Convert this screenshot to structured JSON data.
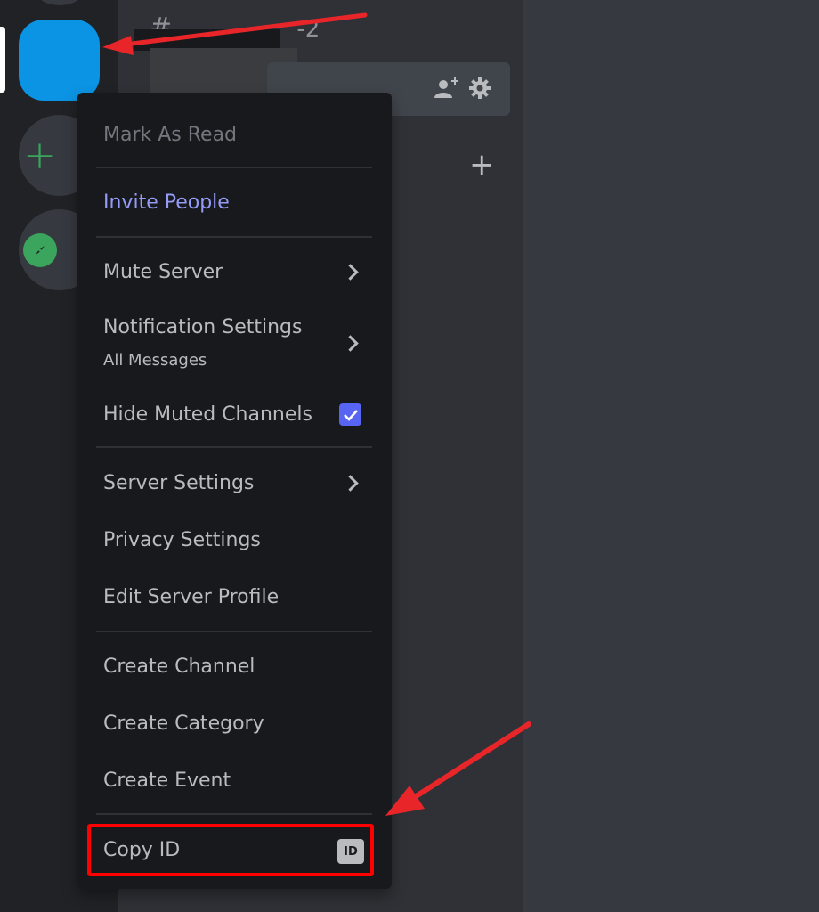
{
  "server_rail": {
    "selected_server_color": "#0b94e3",
    "add_server_icon": "plus-icon",
    "explore_icon": "compass-icon"
  },
  "channel_sidebar": {
    "header_channel_hash": "#",
    "header_channel_suffix": "-2",
    "invite_icon": "add-member-icon",
    "settings_icon": "gear-icon",
    "add_channel_icon": "plus-icon"
  },
  "context_menu": {
    "items": [
      {
        "label": "Mark As Read",
        "state": "disabled"
      },
      {
        "label": "Invite People",
        "state": "brand"
      },
      {
        "label": "Mute Server",
        "submenu": true
      },
      {
        "label": "Notification Settings",
        "sublabel": "All Messages",
        "submenu": true
      },
      {
        "label": "Hide Muted Channels",
        "checked": true
      },
      {
        "label": "Server Settings",
        "submenu": true
      },
      {
        "label": "Privacy Settings"
      },
      {
        "label": "Edit Server Profile"
      },
      {
        "label": "Create Channel"
      },
      {
        "label": "Create Category"
      },
      {
        "label": "Create Event"
      },
      {
        "label": "Copy ID",
        "badge": "ID"
      }
    ]
  },
  "annotations": {
    "highlight_color": "#ff0000",
    "arrow_color": "#e8262a",
    "highlighted_item": "Copy ID"
  },
  "colors": {
    "brand_text": "#949cf7",
    "checkbox": "#5865f2",
    "green": "#3ba55d"
  }
}
